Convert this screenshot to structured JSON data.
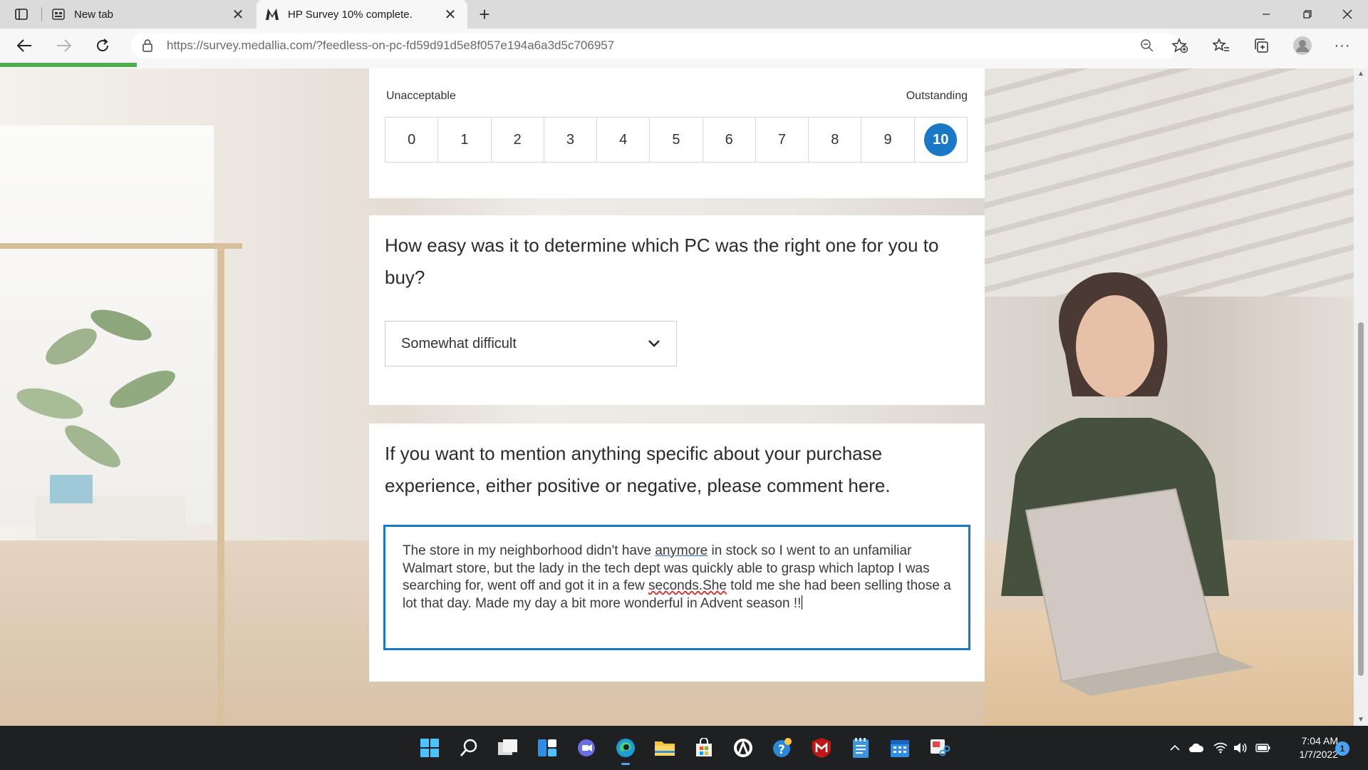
{
  "browser": {
    "tabs": [
      {
        "label": "New tab",
        "icon": "new-tab-page-icon"
      },
      {
        "label": "HP Survey 10% complete.",
        "icon": "medallia-m-icon"
      }
    ],
    "url": "https://survey.medallia.com/?feedless-on-pc-fd59d91d5e8f057e194a6a3d5c706957",
    "load_progress": 0.1,
    "accent": "#4cae4f"
  },
  "survey": {
    "rating": {
      "low_label": "Unacceptable",
      "high_label": "Outstanding",
      "options": [
        "0",
        "1",
        "2",
        "3",
        "4",
        "5",
        "6",
        "7",
        "8",
        "9",
        "10"
      ],
      "selected": "10",
      "selected_color": "#1a79c7"
    },
    "q_ease": {
      "text": "How easy was it to determine which PC was the right one for you to buy?",
      "selected_value": "Somewhat difficult"
    },
    "q_comment": {
      "text": "If you want to mention anything specific about your purchase experience, either positive or negative, please comment here.",
      "answer_parts": [
        "The store in my neighborhood didn't have ",
        "anymore",
        " in stock so I went to an unfamiliar Walmart store, but the lady in the tech dept was quickly able to grasp which laptop I was searching for, went off and got it in a few ",
        "seconds.She",
        " told me she had been selling those a lot that day. Made my day a bit more wonderful in Advent season !!"
      ]
    }
  },
  "taskbar": {
    "apps": [
      "windows-start-icon",
      "search-icon",
      "task-view-icon",
      "widgets-icon",
      "teams-chat-icon",
      "edge-icon",
      "file-explorer-icon",
      "microsoft-store-icon",
      "app-icon",
      "help-icon",
      "mcafee-icon",
      "notepad-icon",
      "calendar-icon",
      "snipping-tool-icon"
    ],
    "time": "7:04 AM",
    "date": "1/7/2022",
    "notifications": "1"
  }
}
